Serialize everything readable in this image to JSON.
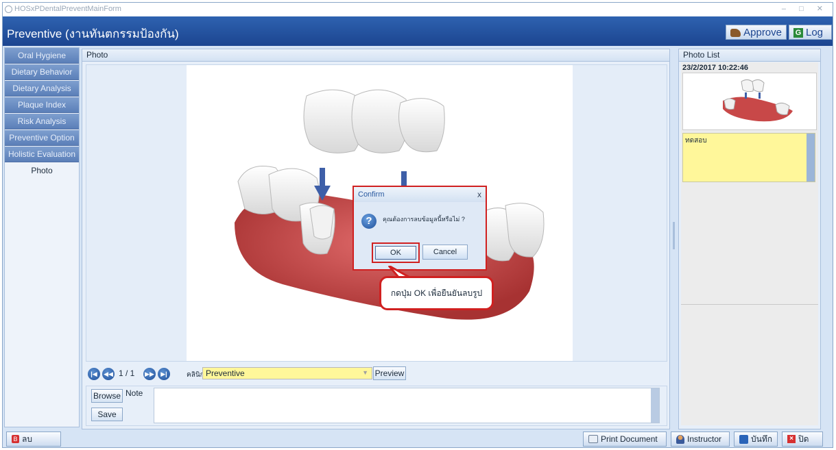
{
  "window": {
    "title": "HOSxPDentalPreventMainForm",
    "controls": "– □ ✕"
  },
  "header": {
    "title": "Preventive (งานทันตกรรมป้องกัน)",
    "approve_label": "Approve",
    "log_label": "Log"
  },
  "nav": {
    "items": [
      {
        "label": "Oral Hygiene"
      },
      {
        "label": "Dietary Behavior"
      },
      {
        "label": "Dietary Analysis"
      },
      {
        "label": "Plaque Index"
      },
      {
        "label": "Risk Analysis"
      },
      {
        "label": "Preventive Option"
      },
      {
        "label": "Holistic Evaluation"
      },
      {
        "label": "Photo"
      }
    ],
    "active": "Photo"
  },
  "photo_panel": {
    "title": "Photo",
    "page_counter": "1 / 1",
    "clinic_label": "คลินิก",
    "clinic_value": "Preventive",
    "preview_label": "Preview",
    "browse_label": "Browse",
    "save_label": "Save",
    "note_label": "Note",
    "note_value": ""
  },
  "photo_list": {
    "title": "Photo List",
    "items": [
      {
        "datetime": "23/2/2017 10:22:46",
        "note": "ทดสอบ"
      }
    ]
  },
  "dialog": {
    "title": "Confirm",
    "message": "คุณต้องการลบข้อมูลนี้หรือไม่ ?",
    "ok_label": "OK",
    "cancel_label": "Cancel"
  },
  "callout": {
    "text": "กดปุ่ม OK เพื่อยืนยันลบรูป"
  },
  "footer": {
    "delete_label": "ลบ",
    "print_label": "Print Document",
    "instructor_label": "Instructor",
    "save_label": "บันทึก",
    "close_label": "ปิด"
  },
  "colors": {
    "header": "#1c4590",
    "highlight": "#d02020",
    "note_bg": "#fff79a"
  }
}
